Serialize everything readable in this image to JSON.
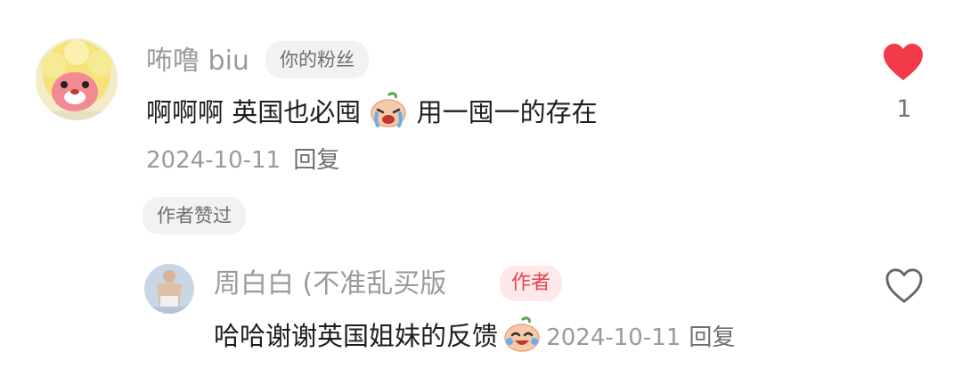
{
  "comment": {
    "username": "咘噜 biu",
    "badge": "你的粉丝",
    "text_before": "啊啊啊 英国也必囤",
    "emoji": "crying-peach-emoji",
    "text_after": "用一囤一的存在",
    "date": "2024-10-11",
    "reply_label": "回复",
    "author_liked_label": "作者赞过",
    "like_count": "1",
    "like_color": "#f23a4a",
    "liked": true
  },
  "reply": {
    "username": "周白白 (不准乱买版",
    "author_badge": "作者",
    "text": "哈哈谢谢英国姐妹的反馈",
    "emoji": "laughing-crying-peach-emoji",
    "date": "2024-10-11",
    "reply_label": "回复",
    "liked": false
  }
}
